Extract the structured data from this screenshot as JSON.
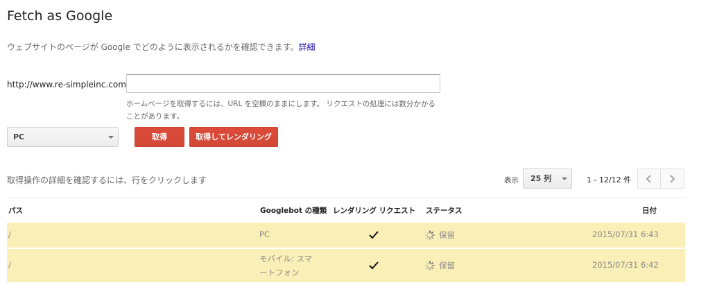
{
  "page": {
    "title": "Fetch as Google",
    "description": "ウェブサイトのページが Google でどのように表示されるかを確認できます。",
    "details_link": "詳細"
  },
  "form": {
    "url_prefix": "http://www.re-simpleinc.com/",
    "url_value": "",
    "helper_text": "ホームページを取得するには、URL を空欄のままにします。 リクエストの処理には数分かかることがあります。",
    "device_selected": "PC",
    "fetch_button": "取得",
    "fetch_render_button": "取得してレンダリング"
  },
  "results": {
    "hint": "取得操作の詳細を確認するには、行をクリックします",
    "show_label": "表示",
    "rows_per_page": "25 列",
    "page_range": "1 - 12/12 件",
    "columns": {
      "path": "パス",
      "googlebot_type": "Googlebot の種類",
      "render_request": "レンダリング リクエスト",
      "status": "ステータス",
      "date": "日付"
    },
    "rows": [
      {
        "path": "/",
        "type_line1": "PC",
        "type_line2": "",
        "render_check": "✓",
        "status": "保留",
        "date": "2015/07/31 6:43"
      },
      {
        "path": "/",
        "type_line1": "モバイル: スマ",
        "type_line2": "ートフォン",
        "render_check": "✓",
        "status": "保留",
        "date": "2015/07/31 6:42"
      }
    ]
  },
  "colors": {
    "accent_red": "#dd4b39",
    "row_highlight": "#fbefb8",
    "link": "#1a0dab"
  }
}
